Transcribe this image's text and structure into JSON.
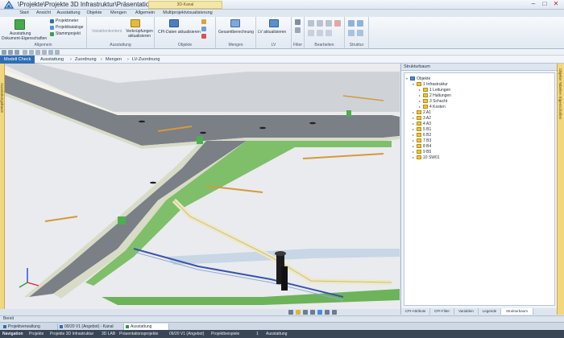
{
  "window": {
    "title": "\\Projekte\\Projekte 3D Infrastruktur\\Präsentationspro...",
    "context_tab": "3D-Kanal"
  },
  "ribbon_tabs": [
    {
      "label": "Start",
      "active": true
    },
    {
      "label": "Ansicht"
    },
    {
      "label": "Ausstattung"
    },
    {
      "label": "Objekte"
    },
    {
      "label": "Mengen"
    },
    {
      "label": "Allgemein"
    },
    {
      "label": "Multiprojektvisualisierung"
    }
  ],
  "ribbon": {
    "allgemein": {
      "label": "Allgemein",
      "ausstattung_button": "Ausstattung",
      "ausstattung_sub": "Dokument-Eigenschaften",
      "projektmeter": "Projektmeter",
      "projektkataloge": "Projektkataloge",
      "stammprojekt": "Stammprojekt"
    },
    "ausstattung": {
      "label": "Ausstattung",
      "variablen": "Variablenkontent",
      "verknuepfungen": "Verknüpfungen aktualisieren"
    },
    "objekte": {
      "label": "Objekte",
      "cpi": "CPI-Daten aktualisieren"
    },
    "mengen": {
      "label": "Mengen",
      "gesamt": "Gesamtberechnung"
    },
    "lv": {
      "label": "LV",
      "lv_update": "LV aktualisieren"
    },
    "filter": {
      "label": "Filter"
    },
    "bearbeiten": {
      "label": "Bearbeiten"
    },
    "struktur": {
      "label": "Struktur"
    }
  },
  "breadcrumbs": [
    "Modell Check",
    "Ausstattung",
    "Zuordnung",
    "Mengen",
    "LV-Zuordnung"
  ],
  "side_strips": {
    "left": "Ausstattungsbaum",
    "right": "Objekte  Tabellen  Eigenschaften"
  },
  "panel": {
    "title": "Strukturbaum",
    "tree": [
      {
        "label": "Objekte",
        "level": 0,
        "expander": "▾",
        "type": "root"
      },
      {
        "label": "1 Infrastruktur",
        "level": 1,
        "expander": "▾"
      },
      {
        "label": "1 Leitungen",
        "level": 2,
        "expander": "▸"
      },
      {
        "label": "2 Haltungen",
        "level": 2,
        "expander": "▸"
      },
      {
        "label": "3 Schacht",
        "level": 2,
        "expander": "▸"
      },
      {
        "label": "4 Kosten",
        "level": 2,
        "expander": "▸"
      },
      {
        "label": "2 A1",
        "level": 1,
        "expander": "▸"
      },
      {
        "label": "3 A2",
        "level": 1,
        "expander": "▸"
      },
      {
        "label": "4 A3",
        "level": 1,
        "expander": "▸"
      },
      {
        "label": "5 B1",
        "level": 1,
        "expander": "▸"
      },
      {
        "label": "6 B2",
        "level": 1,
        "expander": "▸"
      },
      {
        "label": "7 B3",
        "level": 1,
        "expander": "▸"
      },
      {
        "label": "8 B4",
        "level": 1,
        "expander": "▸"
      },
      {
        "label": "9 B5",
        "level": 1,
        "expander": "▸"
      },
      {
        "label": "10 SW01",
        "level": 1,
        "expander": "▸"
      }
    ],
    "tabs": [
      {
        "label": "CPI-Attribute"
      },
      {
        "label": "CPI-Filter"
      },
      {
        "label": "Variablen"
      },
      {
        "label": "Legende"
      },
      {
        "label": "Strukturbaum",
        "active": true
      }
    ]
  },
  "status": {
    "text": "Bereit"
  },
  "doc_tabs": [
    {
      "label": "Projektverwaltung",
      "color": "#2f6db5"
    },
    {
      "label": "09/20 V1 (Angebot) - Kanal",
      "color": "#2f6db5"
    },
    {
      "label": "Ausstattung",
      "color": "#2b9a3f",
      "active": true
    }
  ],
  "navbar": [
    "Navigation",
    "Projekte",
    "Projekte 3D Infrastruktur",
    "3D LAB",
    "Präsentationsprojekte",
    "09/20 V1 (Angebot)",
    "Projektbeispiele",
    "1",
    "Ausstattung"
  ],
  "colors": {
    "accent": "#2f6db5",
    "folder": "#efc43a",
    "strip": "#f3d77c"
  }
}
